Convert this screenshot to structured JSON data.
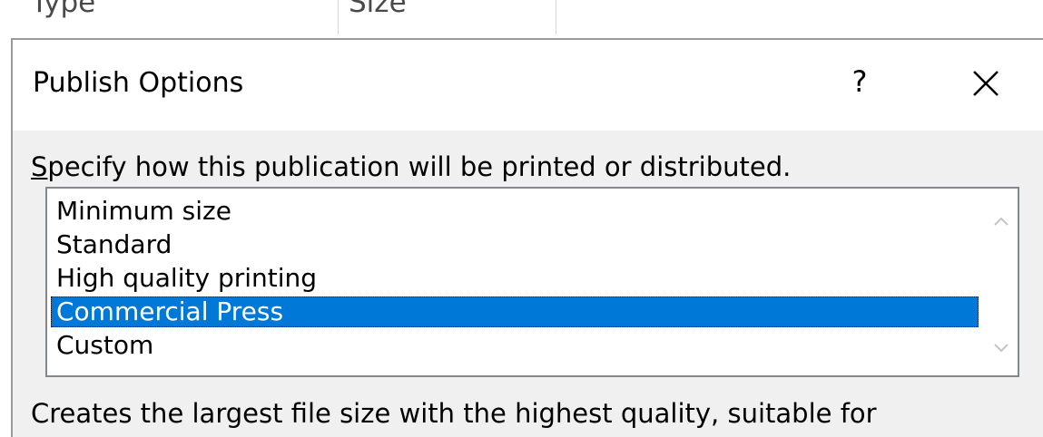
{
  "background_list": {
    "columns": [
      "Type",
      "Size"
    ]
  },
  "dialog": {
    "title": "Publish Options",
    "help_label": "?",
    "close_icon": "close-icon",
    "instruction_accel": "S",
    "instruction_rest": "pecify how this publication will be printed or distributed.",
    "options": [
      {
        "label": "Minimum size",
        "selected": false
      },
      {
        "label": "Standard",
        "selected": false
      },
      {
        "label": "High quality printing",
        "selected": false
      },
      {
        "label": "Commercial Press",
        "selected": true
      },
      {
        "label": "Custom",
        "selected": false
      }
    ],
    "selected_option": "Commercial Press",
    "description": "Creates the largest file size with the highest quality, suitable for"
  },
  "colors": {
    "selection": "#0078d7",
    "dialog_bg": "#f0f0f0",
    "border": "#828790"
  }
}
